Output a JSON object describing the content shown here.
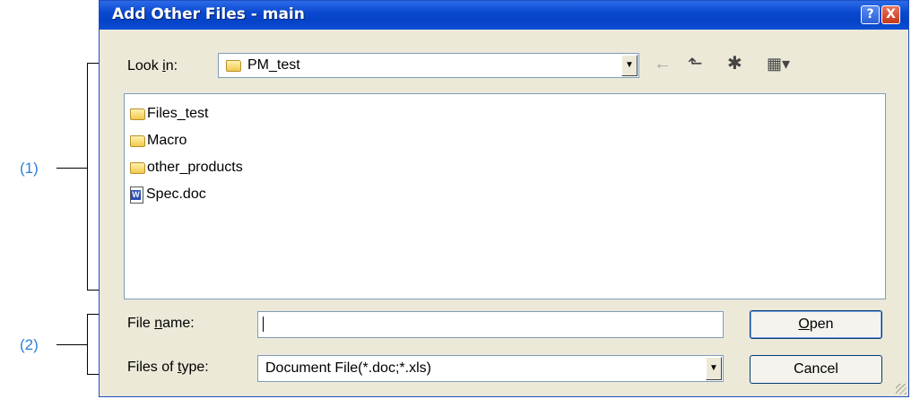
{
  "annotations": {
    "callout_1": "(1)",
    "callout_2": "(2)"
  },
  "dialog": {
    "title": "Add Other Files - main",
    "help_button": "?",
    "close_button": "X",
    "look_in": {
      "label_pre": "Look ",
      "label_accel": "i",
      "label_post": "n:",
      "value": "PM_test",
      "icons": [
        "back-arrow-icon",
        "up-folder-icon",
        "new-folder-icon",
        "view-menu-icon"
      ]
    },
    "files": [
      {
        "name": "Files_test",
        "type": "folder"
      },
      {
        "name": "Macro",
        "type": "folder"
      },
      {
        "name": "other_products",
        "type": "folder"
      },
      {
        "name": "Spec.doc",
        "type": "word-document"
      }
    ],
    "file_name": {
      "label_pre": "File ",
      "label_accel": "n",
      "label_post": "ame:",
      "value": ""
    },
    "file_type": {
      "label_pre": "Files of ",
      "label_accel": "t",
      "label_post": "ype:",
      "value": "Document File(*.doc;*.xls)"
    },
    "open_button": {
      "accel": "O",
      "rest": "pen"
    },
    "cancel_button": "Cancel"
  }
}
